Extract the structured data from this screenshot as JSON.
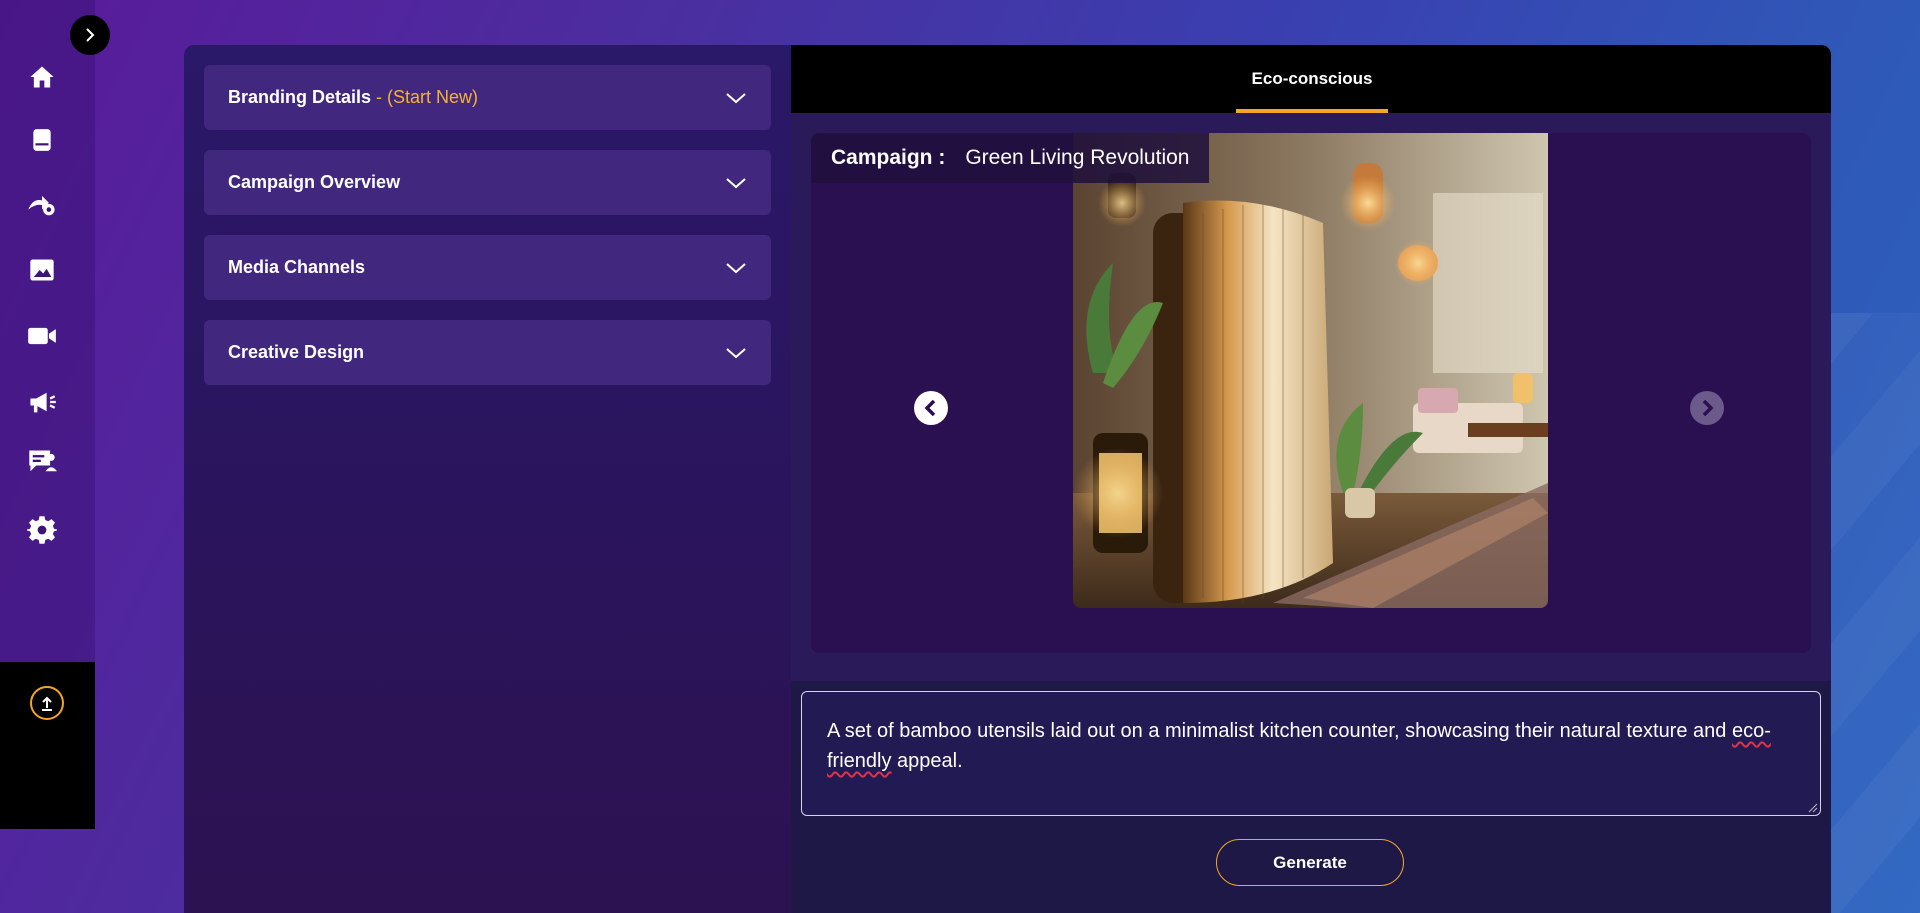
{
  "sidebar": {
    "toggle_icon": "chevron-right-icon",
    "items": [
      {
        "name": "home",
        "icon": "home-icon"
      },
      {
        "name": "book",
        "icon": "book-icon"
      },
      {
        "name": "automation",
        "icon": "gear-arrow-icon"
      },
      {
        "name": "image",
        "icon": "image-icon"
      },
      {
        "name": "video",
        "icon": "video-icon"
      },
      {
        "name": "campaign",
        "icon": "megaphone-icon"
      },
      {
        "name": "feedback",
        "icon": "chat-list-icon"
      },
      {
        "name": "settings",
        "icon": "gear-icon"
      }
    ],
    "upload_icon": "upload-icon"
  },
  "accordions": [
    {
      "title": "Branding Details",
      "subtitle": " - (Start New)"
    },
    {
      "title": "Campaign Overview",
      "subtitle": ""
    },
    {
      "title": "Media Channels",
      "subtitle": ""
    },
    {
      "title": "Creative Design",
      "subtitle": ""
    }
  ],
  "tabs": [
    {
      "label": "Eco-conscious",
      "active": true
    }
  ],
  "campaign": {
    "label": "Campaign :",
    "name": "Green Living Revolution"
  },
  "prompt": {
    "text_before": "A set of bamboo utensils laid out on a minimalist kitchen counter, showcasing their natural texture and ",
    "misspelled": "eco-friendly",
    "text_after": " appeal."
  },
  "generate_label": "Generate",
  "colors": {
    "accent": "#f5a623",
    "accordion_bg": "#41287e",
    "tab_bar": "#000000",
    "panel_bg": "#1d1846"
  }
}
